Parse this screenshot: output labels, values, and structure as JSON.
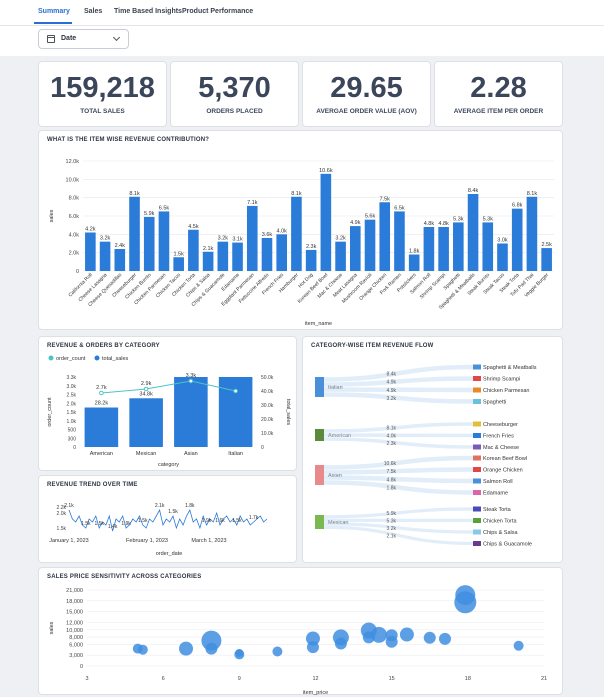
{
  "tabs": [
    {
      "label": "Summary",
      "active": true
    },
    {
      "label": "Sales",
      "active": false
    },
    {
      "label": "Time Based Insights",
      "active": false
    },
    {
      "label": "Product Performance",
      "active": false
    }
  ],
  "filter": {
    "label": "Date"
  },
  "kpis": [
    {
      "value": "159,218",
      "label": "TOTAL SALES"
    },
    {
      "value": "5,370",
      "label": "ORDERS PLACED"
    },
    {
      "value": "29.65",
      "label": "AVERGAE ORDER VALUE (AOV)"
    },
    {
      "value": "2.28",
      "label": "AVERAGE ITEM PER ORDER"
    }
  ],
  "colors": {
    "bar": "#2b7bd9",
    "line": "#4cc4c4",
    "accent": "#2b6cd8"
  },
  "chart_data": [
    {
      "type": "bar",
      "title": "WHAT IS THE ITEM WISE REVENUE CONTRIBUTION?",
      "xlabel": "item_name",
      "ylabel": "sales",
      "ylim": [
        0,
        12000
      ],
      "yticks": [
        "0",
        "2.0k",
        "4.0k",
        "6.0k",
        "8.0k",
        "10.0k",
        "12.0k"
      ],
      "categories": [
        "California Roll",
        "Cheese Lasagna",
        "Cheese Quesadillas",
        "Cheeseburger",
        "Chicken Burrito",
        "Chicken Parmesan",
        "Chicken Tacos",
        "Chicken Torta",
        "Chips & Salsa",
        "Chips & Guacamole",
        "Edamame",
        "Eggplant Parmesan",
        "Fettuccine Alfredo",
        "French Fries",
        "Hamburger",
        "Hot Dog",
        "Korean Beef Bowl",
        "Mac & Cheese",
        "Meat Lasagna",
        "Mushroom Ravioli",
        "Orange Chicken",
        "Pork Ramen",
        "Potstickers",
        "Salmon Roll",
        "Shrimp Scampi",
        "Spaghetti",
        "Spaghetti & Meatballs",
        "Steak Burrito",
        "Steak Tacos",
        "Steak Torta",
        "Tofu Pad Thai",
        "Veggie Burger"
      ],
      "values": [
        4200,
        3200,
        2400,
        8100,
        5900,
        6500,
        1500,
        4500,
        2100,
        3200,
        3100,
        7100,
        3600,
        4000,
        8100,
        2300,
        10600,
        3200,
        4900,
        5600,
        7500,
        6500,
        1800,
        4800,
        4800,
        5300,
        8400,
        5300,
        3000,
        6800,
        8100,
        2500
      ],
      "labels": [
        "4.2k",
        "3.2k",
        "2.4k",
        "8.1k",
        "5.9k",
        "6.5k",
        "1.5k",
        "4.5k",
        "2.1k",
        "3.2k",
        "3.1k",
        "7.1k",
        "3.6k",
        "4.0k",
        "8.1k",
        "2.3k",
        "10.6k",
        "3.2k",
        "4.9k",
        "5.6k",
        "7.5k",
        "6.5k",
        "1.8k",
        "4.8k",
        "4.8k",
        "5.3k",
        "8.4k",
        "5.3k",
        "3.0k",
        "6.8k",
        "8.1k",
        "2.5k"
      ],
      "grid": true
    },
    {
      "type": "bar",
      "title": "REVENUE & ORDERS BY CATEGORY",
      "xlabel": "category",
      "ylabel": "order_count",
      "y2label": "total_sales",
      "legend": [
        "order_count",
        "total_sales"
      ],
      "legend_placement": "top-left",
      "categories": [
        "American",
        "Mexican",
        "Asian",
        "Italian"
      ],
      "ylim": [
        0,
        3500
      ],
      "yticks": [
        "0",
        "300",
        "500",
        "1.0k",
        "1.5k",
        "2.0k",
        "2.5k",
        "3.0k",
        "3.3k"
      ],
      "y2ticks": [
        "0",
        "10.0k",
        "20.0k",
        "30.0k",
        "40.0k",
        "50.0k"
      ],
      "y2lim": [
        0,
        50000
      ],
      "series": [
        {
          "name": "order_count",
          "type": "line",
          "values": [
            2700,
            2900,
            3300,
            2800
          ],
          "labels": [
            "2.7k",
            "2.9k",
            "3.3k",
            ""
          ]
        },
        {
          "name": "total_sales",
          "type": "bar",
          "values": [
            28200,
            34800,
            50000,
            50000
          ],
          "labels": [
            "28.2k",
            "34.8k",
            "",
            ""
          ]
        }
      ]
    },
    {
      "type": "line",
      "title": "REVENUE TREND OVER TIME",
      "xlabel": "order_date",
      "ylim": [
        1500,
        2300
      ],
      "yticks": [
        "1.5k",
        "2.0k",
        "2.2k"
      ],
      "xticks": [
        "January 1, 2023",
        "February 1, 2023",
        "March 1, 2023"
      ],
      "values": [
        2100,
        1800,
        1700,
        1900,
        1600,
        1500,
        1800,
        1700,
        1900,
        1500,
        1700,
        1600,
        1900,
        1400,
        1800,
        1700,
        1900,
        1500,
        1600,
        1800,
        1700,
        1900,
        1600,
        1500,
        1800,
        1700,
        1900,
        2100,
        1600,
        1800,
        1700,
        1900,
        1500,
        1800,
        1600,
        1900,
        2100,
        1700,
        1800,
        1500,
        1900,
        1600,
        1800,
        1700,
        2000,
        1600,
        1800,
        1900,
        1700,
        1800,
        1600,
        1900,
        1700,
        1800,
        1600,
        1700,
        1800,
        1900,
        1700,
        1800
      ],
      "labels": [
        "2.1k",
        "1.5k",
        "1.5k",
        "1.4k",
        "1.9k",
        "1.5k",
        "2.1k",
        "1.5k",
        "1.8k",
        "1.9k",
        "1.6k",
        "1.5k",
        "1.7k"
      ]
    },
    {
      "type": "scatter",
      "title": "SALES PRICE SENSITIVITY ACROSS CATEGORIES",
      "xlabel": "item_price",
      "ylabel": "sales",
      "xlim": [
        3,
        21
      ],
      "ylim": [
        0,
        21000
      ],
      "xticks": [
        "3",
        "6",
        "9",
        "12",
        "15",
        "18",
        "21"
      ],
      "yticks": [
        "0",
        "3,000",
        "6,000",
        "8,000",
        "10,000",
        "12,000",
        "15,000",
        "18,000",
        "21,000"
      ],
      "points": [
        {
          "x": 5,
          "y": 4800,
          "size": 5
        },
        {
          "x": 5.2,
          "y": 4500,
          "size": 5
        },
        {
          "x": 6.9,
          "y": 4800,
          "size": 7
        },
        {
          "x": 7.9,
          "y": 7000,
          "size": 10
        },
        {
          "x": 7.9,
          "y": 4800,
          "size": 6
        },
        {
          "x": 9.0,
          "y": 3200,
          "size": 5
        },
        {
          "x": 9.0,
          "y": 3600,
          "size": 4
        },
        {
          "x": 10.5,
          "y": 4000,
          "size": 5
        },
        {
          "x": 11.9,
          "y": 5200,
          "size": 6
        },
        {
          "x": 11.9,
          "y": 7600,
          "size": 7
        },
        {
          "x": 13.0,
          "y": 6200,
          "size": 6
        },
        {
          "x": 13.0,
          "y": 7900,
          "size": 8
        },
        {
          "x": 14.1,
          "y": 9800,
          "size": 8
        },
        {
          "x": 14.1,
          "y": 7900,
          "size": 6
        },
        {
          "x": 14.5,
          "y": 8600,
          "size": 8
        },
        {
          "x": 15.0,
          "y": 8500,
          "size": 6
        },
        {
          "x": 15.0,
          "y": 6700,
          "size": 6
        },
        {
          "x": 15.6,
          "y": 8700,
          "size": 7
        },
        {
          "x": 16.5,
          "y": 7800,
          "size": 6
        },
        {
          "x": 17.1,
          "y": 7500,
          "size": 6
        },
        {
          "x": 17.9,
          "y": 17600,
          "size": 11
        },
        {
          "x": 17.9,
          "y": 19600,
          "size": 10
        },
        {
          "x": 20.0,
          "y": 5600,
          "size": 5
        }
      ]
    },
    {
      "type": "sankey",
      "title": "CATEGORY-WISE ITEM REVENUE FLOW",
      "categories": [
        {
          "name": "Italian",
          "color": "#4a90d9",
          "flows": [
            {
              "value": "8.4k",
              "item": "Spaghetti & Meatballs",
              "color": "#4a90d9"
            },
            {
              "value": "4.9k",
              "item": "Shrimp Scampi",
              "color": "#e04848"
            },
            {
              "value": "4.9k",
              "item": "Chicken Parmesan",
              "color": "#e88a2a"
            },
            {
              "value": "3.2k",
              "item": "Spaghetti",
              "color": "#6ac2d8"
            }
          ]
        },
        {
          "name": "American",
          "color": "#5a8a3a",
          "flows": [
            {
              "value": "8.1k",
              "item": "Cheeseburger",
              "color": "#e0c03a"
            },
            {
              "value": "4.0k",
              "item": "French Fries",
              "color": "#2b7bd9"
            },
            {
              "value": "2.3k",
              "item": "Mac & Cheese",
              "color": "#7a5ab8"
            }
          ]
        },
        {
          "name": "Asian",
          "color": "#e88a8a",
          "flows": [
            {
              "value": "10.6k",
              "item": "Korean Beef Bowl",
              "color": "#e07060"
            },
            {
              "value": "7.5k",
              "item": "Orange Chicken",
              "color": "#e04848"
            },
            {
              "value": "4.8k",
              "item": "Salmon Roll",
              "color": "#4a90d9"
            },
            {
              "value": "1.8k",
              "item": "Edamame",
              "color": "#d866a8"
            }
          ]
        },
        {
          "name": "Mexican",
          "color": "#7ab850",
          "flows": [
            {
              "value": "5.9k",
              "item": "Steak Torta",
              "color": "#4a4ab8"
            },
            {
              "value": "5.3k",
              "item": "Chicken Torta",
              "color": "#5aa03a"
            },
            {
              "value": "3.2k",
              "item": "Chips & Salsa",
              "color": "#88c8e8"
            },
            {
              "value": "2.1k",
              "item": "Chips & Guacamole",
              "color": "#6a3a8a"
            }
          ]
        }
      ]
    }
  ]
}
